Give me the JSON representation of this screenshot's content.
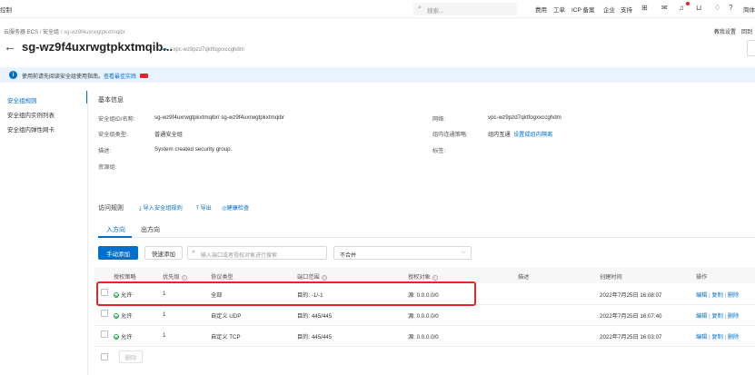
{
  "topbar": {
    "left_text": "控制",
    "search_placeholder": "搜索...",
    "nav": [
      "费用",
      "工单",
      "ICP 备案",
      "企业",
      "支持"
    ],
    "icons": [
      "terminal-icon",
      "mail-icon",
      "bell-icon",
      "cart-icon",
      "help-icon",
      "hint-icon"
    ],
    "right_text": "简体"
  },
  "breadcrumb": {
    "items": [
      "云服务器 ECS",
      "安全组",
      "sg-wz9f4uxrwgtpkxtmqibr"
    ]
  },
  "header": {
    "title": "sg-wz9f4uxrwgtpkxtmqib...",
    "vpc": "/ vpc-wz9pzd7qktfogxxccghdm",
    "right_links": [
      "教我设置",
      "回到"
    ]
  },
  "notice": {
    "text": "使用前请先阅读安全组使用指南，查看最佳实践",
    "text_main": "使用前请先阅读安全组使用指南。",
    "link": "查看最佳实践"
  },
  "sidebar": {
    "items": [
      {
        "label": "安全组规则",
        "active": true
      },
      {
        "label": "安全组内实例列表",
        "active": false
      },
      {
        "label": "安全组内弹性网卡",
        "active": false
      }
    ]
  },
  "basic_info": {
    "heading": "基本信息",
    "left": [
      {
        "label": "安全组ID/名称:",
        "value": "sg-wz9f4uxrwgtpkxtmqibr/ sg-wz9f4uxrwgtpkxtmqibr"
      },
      {
        "label": "安全组类型:",
        "value": "普通安全组"
      },
      {
        "label": "描述:",
        "value": "System created security group."
      },
      {
        "label": "资源组:",
        "value": ""
      }
    ],
    "right": [
      {
        "label": "网络:",
        "value": "vpc-wz9pzd7qktfogxxccghdm",
        "link": ""
      },
      {
        "label": "组内连通策略:",
        "value": "组内互通",
        "link": "设置成组内隔离"
      },
      {
        "label": "标签:",
        "value": "",
        "link": ""
      }
    ]
  },
  "rules_section": {
    "heading": "访问规则",
    "actions": [
      "导入安全组规则",
      "导出",
      "健康检查"
    ],
    "tabs": [
      {
        "label": "入方向",
        "active": true
      },
      {
        "label": "出方向",
        "active": false
      }
    ],
    "toolbar": {
      "manual_add": "手动添加",
      "quick_add": "快速添加",
      "search_placeholder": "输入端口或者授权对象进行搜索",
      "select_value": "不合并"
    },
    "columns": [
      "授权策略",
      "优先级",
      "协议类型",
      "端口范围",
      "授权对象",
      "描述",
      "创建时间",
      "操作"
    ],
    "rows": [
      {
        "policy": "允许",
        "priority": "1",
        "protocol": "全部",
        "port": "目的: -1/-1",
        "source": "源: 0.0.0.0/0",
        "desc": "",
        "created": "2022年7月25日 16:08:07",
        "ops": [
          "编辑",
          "复制",
          "删除"
        ],
        "highlighted": true
      },
      {
        "policy": "允许",
        "priority": "1",
        "protocol": "自定义 UDP",
        "port": "目的: 445/445",
        "source": "源: 0.0.0.0/0",
        "desc": "",
        "created": "2022年7月25日 16:07:40",
        "ops": [
          "编辑",
          "复制",
          "删除"
        ],
        "highlighted": false
      },
      {
        "policy": "允许",
        "priority": "1",
        "protocol": "自定义 TCP",
        "port": "目的: 445/445",
        "source": "源: 0.0.0.0/0",
        "desc": "",
        "created": "2022年7月25日 16:03:07",
        "ops": [
          "编辑",
          "复制",
          "删除"
        ],
        "highlighted": false
      }
    ],
    "bulk_delete": "删除"
  },
  "colors": {
    "accent": "#0070cc",
    "primary_button": "#0070cc",
    "highlight_box": "#e4252b",
    "notice_bg": "#e8f3ff",
    "ok": "#2fa84f"
  }
}
